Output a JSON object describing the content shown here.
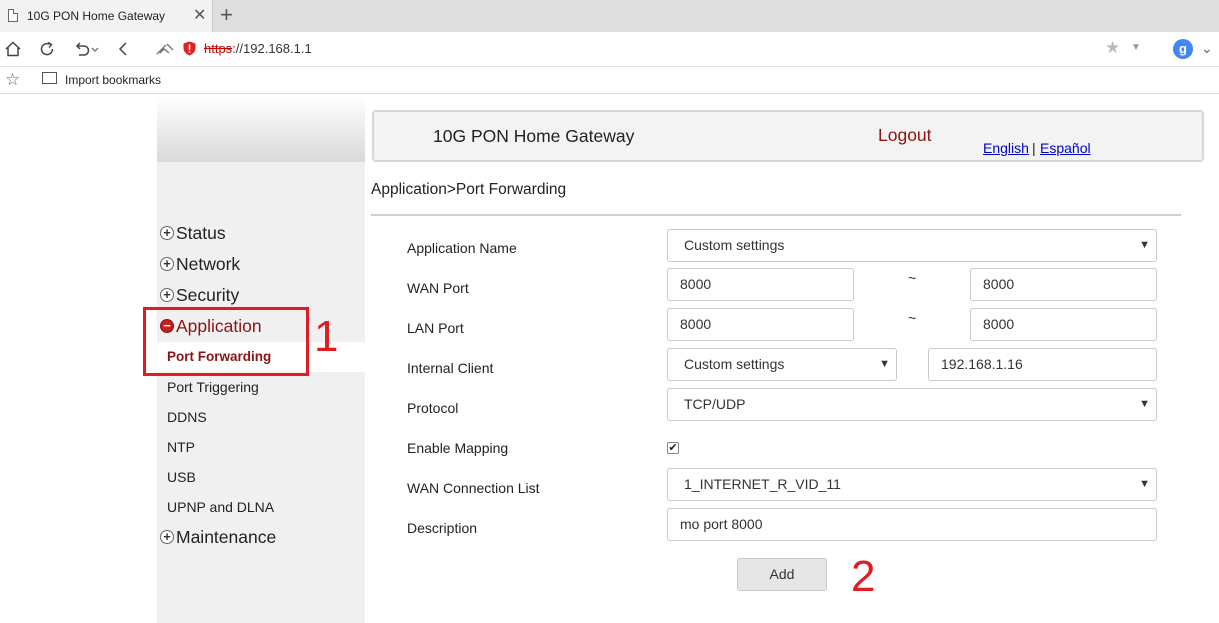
{
  "browser": {
    "tab_title": "10G PON Home Gateway",
    "close_glyph": "✕",
    "new_tab_glyph": "+",
    "url_scheme": "https",
    "url_rest": "://192.168.1.1",
    "profile_letter": "g",
    "bookmark_import": "Import bookmarks"
  },
  "header": {
    "title": "10G PON Home Gateway",
    "logout": "Logout",
    "lang_english": "English",
    "lang_separator": "|",
    "lang_spanish": "Español"
  },
  "breadcrumb": "Application>Port Forwarding",
  "sidebar": {
    "items": [
      "Status",
      "Network",
      "Security",
      "Application",
      "Maintenance"
    ],
    "application_sub": [
      "Port Forwarding",
      "Port Triggering",
      "DDNS",
      "NTP",
      "USB",
      "UPNP and DLNA"
    ]
  },
  "form": {
    "labels": {
      "app_name": "Application Name",
      "wan_port": "WAN Port",
      "lan_port": "LAN Port",
      "internal_client": "Internal Client",
      "protocol": "Protocol",
      "enable_mapping": "Enable Mapping",
      "wan_connection": "WAN Connection List",
      "description": "Description"
    },
    "app_name_value": "Custom settings",
    "wan_port_start": "8000",
    "wan_port_end": "8000",
    "lan_port_start": "8000",
    "lan_port_end": "8000",
    "range_sep": "~",
    "internal_client_mode": "Custom settings",
    "internal_client_ip": "192.168.1.16",
    "protocol_value": "TCP/UDP",
    "enable_mapping_checked": true,
    "wan_connection_value": "1_INTERNET_R_VID_11",
    "description_value": "mo port 8000",
    "add_label": "Add"
  },
  "annotations": {
    "step1": "1",
    "step2": "2",
    "highlight_color": "#e11b22"
  }
}
